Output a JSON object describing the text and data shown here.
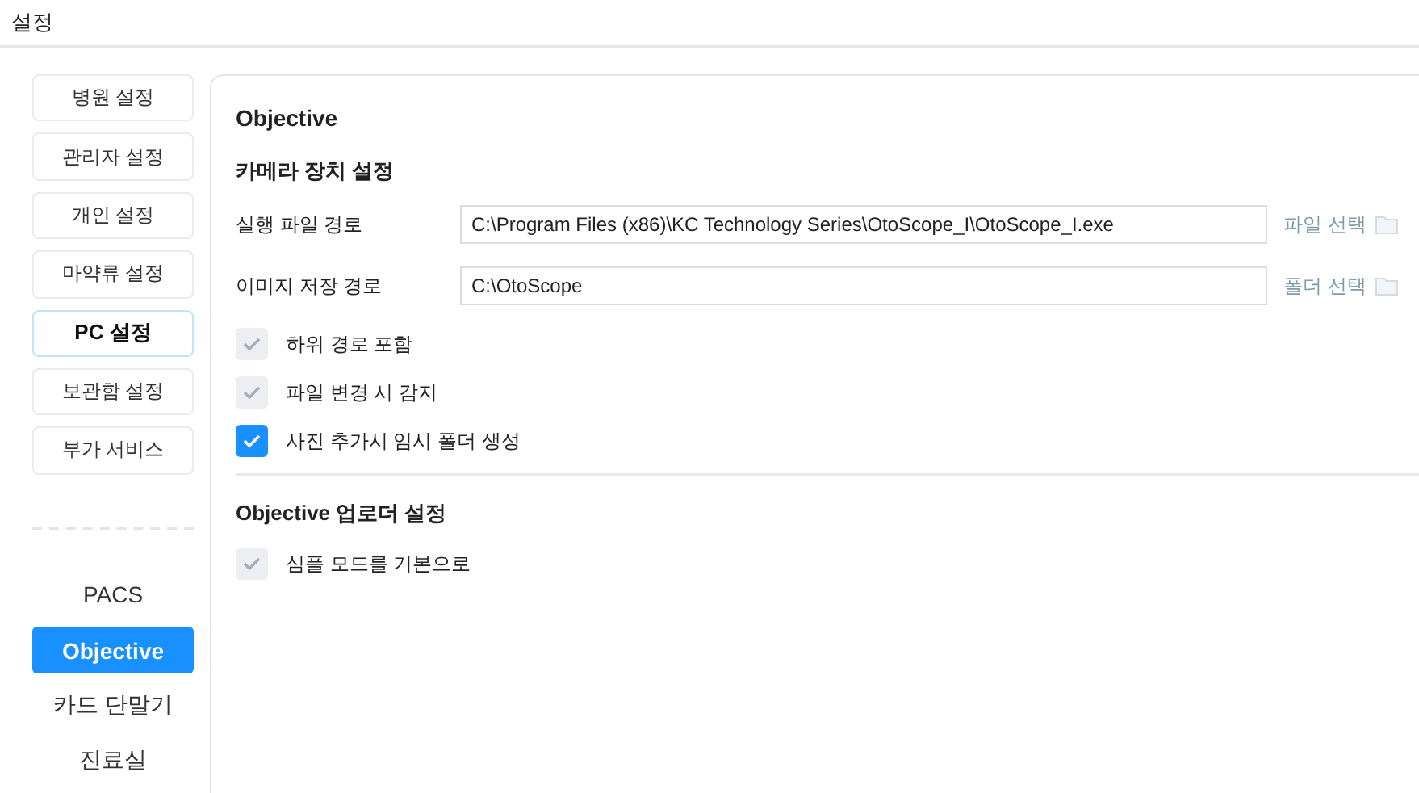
{
  "window": {
    "title": "설정"
  },
  "sidebar": {
    "settings_buttons": [
      {
        "label": "병원 설정",
        "selected": false
      },
      {
        "label": "관리자 설정",
        "selected": false
      },
      {
        "label": "개인 설정",
        "selected": false
      },
      {
        "label": "마약류 설정",
        "selected": false
      },
      {
        "label": "PC 설정",
        "selected": true
      },
      {
        "label": "보관함 설정",
        "selected": false
      },
      {
        "label": "부가 서비스",
        "selected": false
      }
    ],
    "pages": [
      {
        "label": "PACS",
        "selected": false
      },
      {
        "label": "Objective",
        "selected": true
      },
      {
        "label": "카드 단말기",
        "selected": false
      },
      {
        "label": "진료실",
        "selected": false
      }
    ]
  },
  "panel": {
    "heading": "Objective",
    "sections": [
      {
        "title": "카메라 장치 설정",
        "paths": [
          {
            "label": "실행 파일 경로",
            "value": "C:\\Program Files (x86)\\KC Technology Series\\OtoScope_I\\OtoScope_I.exe",
            "action": "파일 선택"
          },
          {
            "label": "이미지 저장 경로",
            "value": "C:\\OtoScope",
            "action": "폴더 선택"
          }
        ],
        "options": [
          {
            "label": "하위 경로 포함",
            "checked": true,
            "disabled": true
          },
          {
            "label": "파일 변경 시 감지",
            "checked": true,
            "disabled": true
          },
          {
            "label": "사진 추가시 임시 폴더 생성",
            "checked": true,
            "disabled": false
          }
        ]
      },
      {
        "title": "Objective 업로더 설정",
        "options": [
          {
            "label": "심플 모드를 기본으로",
            "checked": true,
            "disabled": true
          }
        ]
      }
    ]
  }
}
